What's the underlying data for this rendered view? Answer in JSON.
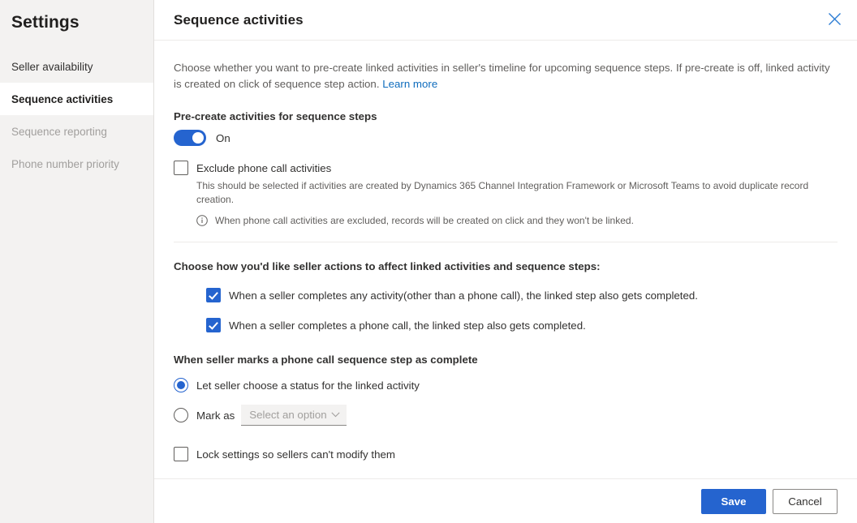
{
  "sidebar": {
    "title": "Settings",
    "items": [
      {
        "label": "Seller availability",
        "state": "normal"
      },
      {
        "label": "Sequence activities",
        "state": "active"
      },
      {
        "label": "Sequence reporting",
        "state": "disabled"
      },
      {
        "label": "Phone number priority",
        "state": "disabled"
      }
    ]
  },
  "header": {
    "title": "Sequence activities",
    "close_icon": "close-icon"
  },
  "description": {
    "text": "Choose whether you want to pre-create linked activities in seller's timeline for upcoming sequence steps. If pre-create is off, linked activity is created on click of sequence step action.",
    "link_label": "Learn more"
  },
  "precreate": {
    "label": "Pre-create activities for sequence steps",
    "toggle_state": "On",
    "toggle_on": true
  },
  "exclude_phone": {
    "label": "Exclude phone call activities",
    "checked": false,
    "note": "This should be selected if activities are created by Dynamics 365 Channel Integration Framework or Microsoft Teams to avoid duplicate record creation.",
    "info_icon": "info-icon",
    "info_text": "When phone call activities are excluded, records will be created on click and they won't be linked."
  },
  "seller_actions": {
    "title": "Choose how you'd like seller actions to affect linked activities and sequence steps:",
    "options": [
      {
        "label": "When a seller completes any activity(other than a phone call), the linked step also gets completed.",
        "checked": true
      },
      {
        "label": "When a seller completes a phone call, the linked step also gets completed.",
        "checked": true
      }
    ]
  },
  "phone_complete": {
    "title": "When seller marks a phone call sequence step as complete",
    "option_let_seller": "Let seller choose a status for the linked activity",
    "option_mark_as": "Mark as",
    "selected": "let_seller",
    "dropdown_placeholder": "Select an option",
    "dropdown_icon": "chevron-down-icon"
  },
  "lock_settings": {
    "label": "Lock settings so sellers can't modify them",
    "checked": false
  },
  "footer": {
    "save_label": "Save",
    "cancel_label": "Cancel"
  },
  "colors": {
    "accent": "#2564cf",
    "link": "#0f6cbd",
    "sidebar_bg": "#f3f2f1"
  }
}
